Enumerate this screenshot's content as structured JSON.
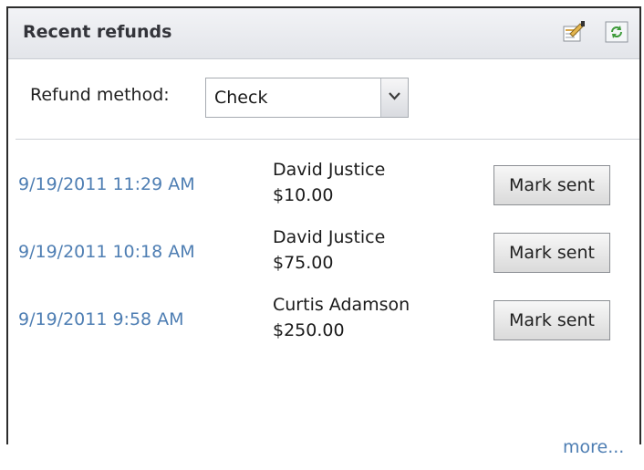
{
  "panel": {
    "title": "Recent refunds",
    "header_icons": [
      "export-icon",
      "refresh-icon"
    ]
  },
  "filter": {
    "label": "Refund method:",
    "selected": "Check"
  },
  "refunds": [
    {
      "date": "9/19/2011 11:29 AM",
      "name": "David Justice",
      "amount": "$10.00",
      "action": "Mark sent"
    },
    {
      "date": "9/19/2011 10:18 AM",
      "name": "David Justice",
      "amount": "$75.00",
      "action": "Mark sent"
    },
    {
      "date": "9/19/2011 9:58 AM",
      "name": "Curtis Adamson",
      "amount": "$250.00",
      "action": "Mark sent"
    }
  ],
  "footer": {
    "more_label": "more..."
  },
  "colors": {
    "link": "#4e7eb3",
    "header_bg": "#e8e9ed"
  }
}
